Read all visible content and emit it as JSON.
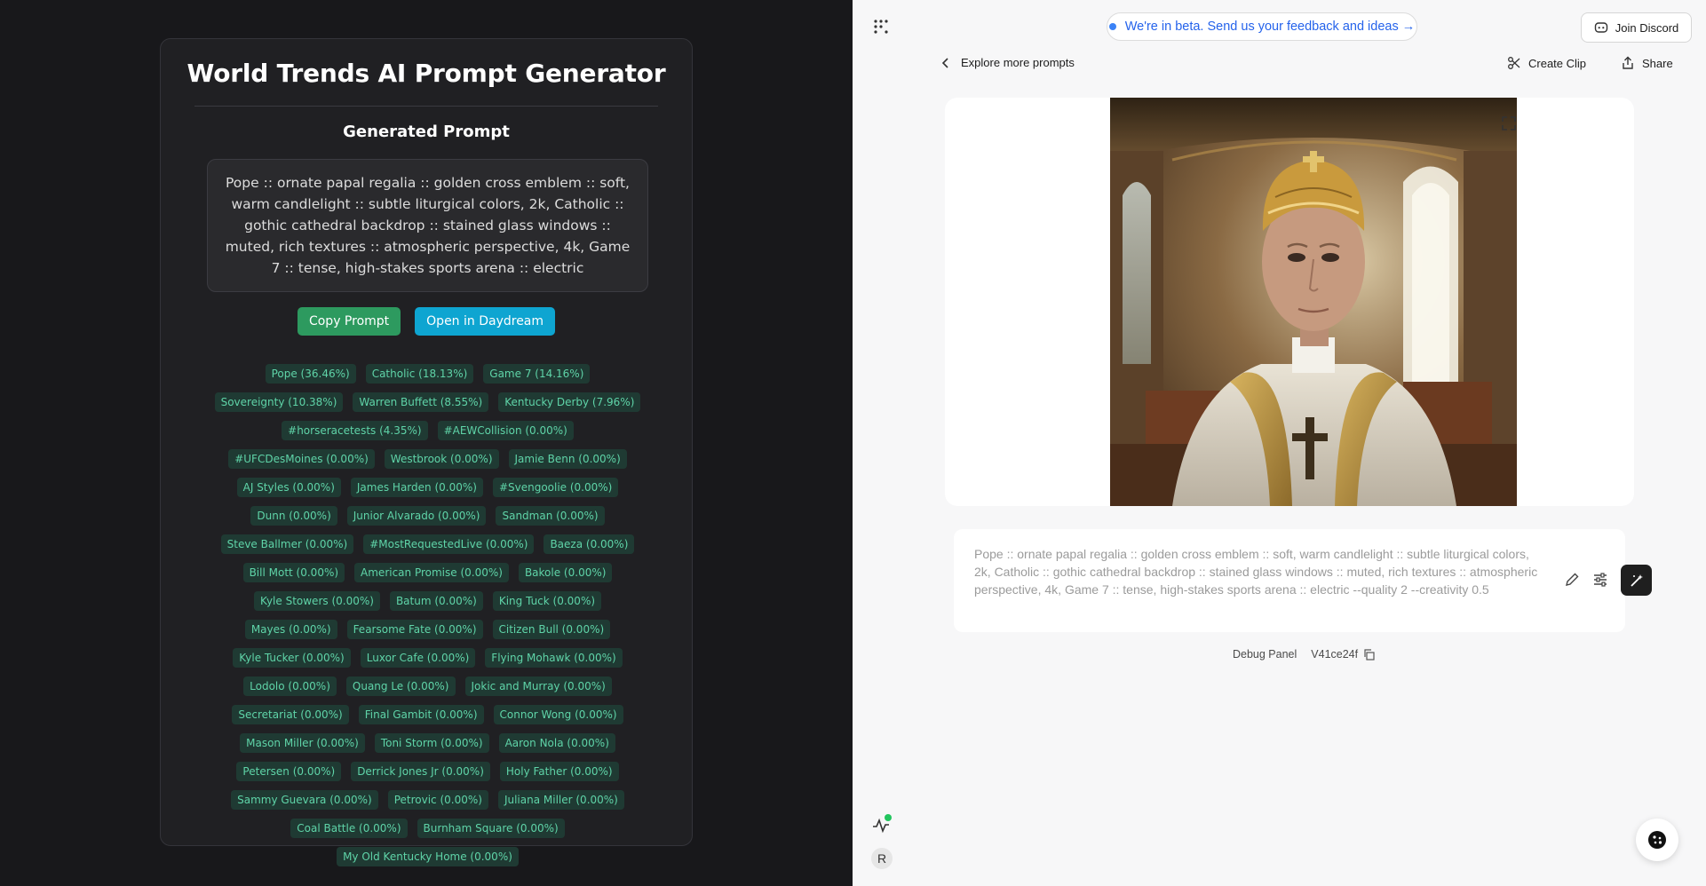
{
  "generator": {
    "title": "World Trends AI Prompt Generator",
    "section_heading": "Generated Prompt",
    "prompt": "Pope :: ornate papal regalia :: golden cross emblem :: soft, warm candlelight :: subtle liturgical colors, 2k, Catholic :: gothic cathedral backdrop :: stained glass windows :: muted, rich textures :: atmospheric perspective, 4k, Game 7 :: tense, high-stakes sports arena :: electric",
    "copy_button": "Copy Prompt",
    "open_button": "Open in Daydream",
    "copy_button_color": "#2d9a5f",
    "open_button_color": "#0ea5d1",
    "tags": [
      "Pope (36.46%)",
      "Catholic (18.13%)",
      "Game 7 (14.16%)",
      "Sovereignty (10.38%)",
      "Warren Buffett (8.55%)",
      "Kentucky Derby (7.96%)",
      "#horseracetests (4.35%)",
      "#AEWCollision (0.00%)",
      "#UFCDesMoines (0.00%)",
      "Westbrook (0.00%)",
      "Jamie Benn (0.00%)",
      "AJ Styles (0.00%)",
      "James Harden (0.00%)",
      "#Svengoolie (0.00%)",
      "Dunn (0.00%)",
      "Junior Alvarado (0.00%)",
      "Sandman (0.00%)",
      "Steve Ballmer (0.00%)",
      "#MostRequestedLive (0.00%)",
      "Baeza (0.00%)",
      "Bill Mott (0.00%)",
      "American Promise (0.00%)",
      "Bakole (0.00%)",
      "Kyle Stowers (0.00%)",
      "Batum (0.00%)",
      "King Tuck (0.00%)",
      "Mayes (0.00%)",
      "Fearsome Fate (0.00%)",
      "Citizen Bull (0.00%)",
      "Kyle Tucker (0.00%)",
      "Luxor Cafe (0.00%)",
      "Flying Mohawk (0.00%)",
      "Lodolo (0.00%)",
      "Quang Le (0.00%)",
      "Jokic and Murray (0.00%)",
      "Secretariat (0.00%)",
      "Final Gambit (0.00%)",
      "Connor Wong (0.00%)",
      "Mason Miller (0.00%)",
      "Toni Storm (0.00%)",
      "Aaron Nola (0.00%)",
      "Petersen (0.00%)",
      "Derrick Jones Jr (0.00%)",
      "Holy Father (0.00%)",
      "Sammy Guevara (0.00%)",
      "Petrovic (0.00%)",
      "Juliana Miller (0.00%)",
      "Coal Battle (0.00%)",
      "Burnham Square (0.00%)",
      "My Old Kentucky Home (0.00%)"
    ]
  },
  "daydream": {
    "beta_banner": "We're in beta. Send us your feedback and ideas →",
    "join_discord": "Join Discord",
    "explore_link": "Explore more prompts",
    "create_clip": "Create Clip",
    "share": "Share",
    "prompt_input": "Pope :: ornate papal regalia :: golden cross emblem :: soft, warm candlelight :: subtle liturgical colors, 2k,  Catholic :: gothic cathedral backdrop :: stained glass windows :: muted, rich textures :: atmospheric perspective, 4k,  Game 7 :: tense, high-stakes sports arena :: electric --quality 2 --creativity 0.5",
    "debug_panel": "Debug Panel",
    "version": "V41ce24f",
    "avatar_initial": "R",
    "accent_color": "#2563eb",
    "status_dot_color": "#22c55e"
  },
  "icons": {
    "grid": "grid-dots-icon",
    "back": "chevron-left-icon",
    "scissors": "scissors-icon",
    "share": "share-icon",
    "discord": "discord-icon",
    "expand": "expand-icon",
    "edit": "pencil-icon",
    "sliders": "sliders-icon",
    "magic": "magic-wand-icon",
    "copy": "copy-icon",
    "activity": "activity-icon",
    "fab": "cookie-icon"
  }
}
